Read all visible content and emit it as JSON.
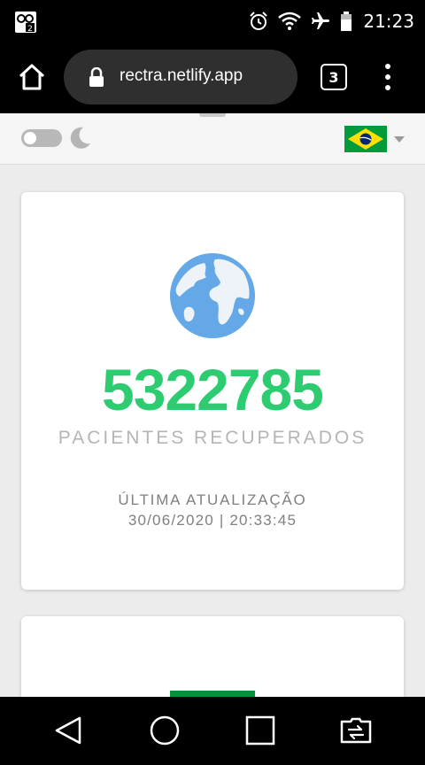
{
  "status_bar": {
    "time": "21:23",
    "icons": [
      "app-notification-icon",
      "alarm-icon",
      "wifi-icon",
      "airplane-mode-icon",
      "battery-icon"
    ]
  },
  "browser": {
    "url": "rectra.netlify.app",
    "tab_count": "3"
  },
  "settings": {
    "theme": "light",
    "language_flag": "brazil-flag"
  },
  "stats_card": {
    "number": "5322785",
    "label": "PACIENTES RECUPERADOS",
    "updated_label": "ÚLTIMA ATUALIZAÇÃO",
    "updated_time": "30/06/2020 | 20:33:45"
  },
  "colors": {
    "accent_green": "#2ecc71",
    "globe_blue": "#64a8e8",
    "flag_green": "#009b3a",
    "flag_yellow": "#fedf00",
    "flag_blue": "#002776"
  }
}
